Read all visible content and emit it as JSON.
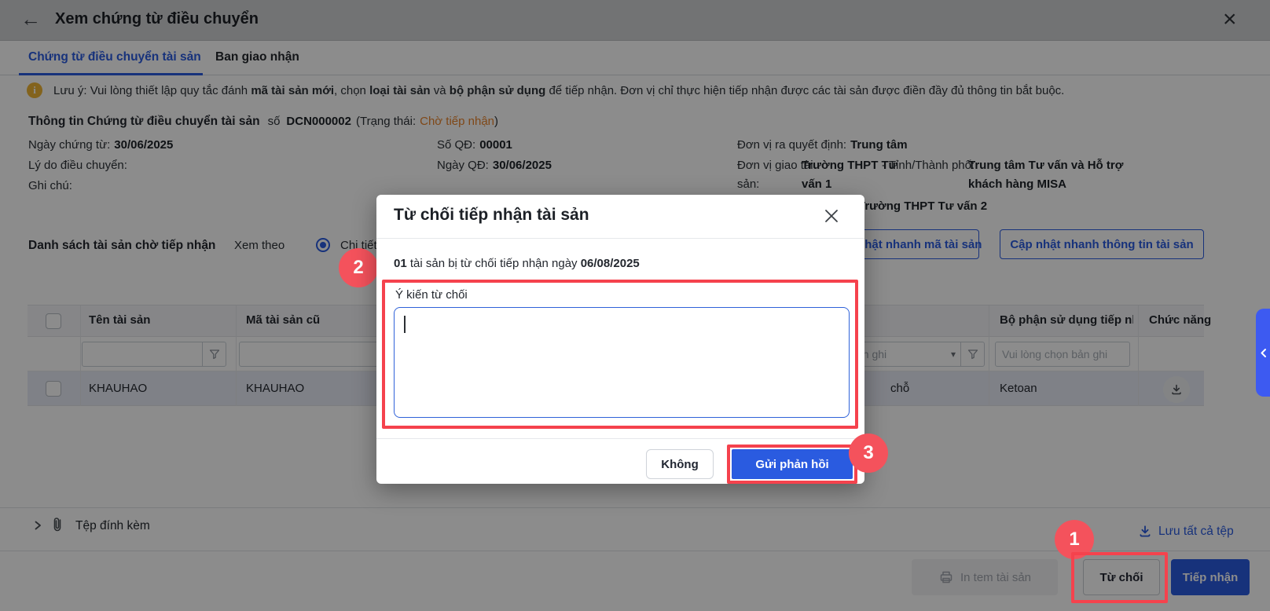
{
  "window": {
    "title": "Xem chứng từ điều chuyển"
  },
  "tabs": {
    "tab1": "Chứng từ điều chuyển tài sản",
    "tab2": "Ban giao nhận"
  },
  "notice": {
    "n1": "Lưu ý: Vui lòng thiết lập quy tắc đánh ",
    "n2": "mã tài sản mới",
    "n3": ", chọn ",
    "n4": "loại tài sản",
    "n5": " và ",
    "n6": "bộ phận sử dụng",
    "n7": " để tiếp nhận. Đơn vị chỉ thực hiện tiếp nhận được các tài sản được điền đầy đủ thông tin bắt buộc."
  },
  "info": {
    "section_title": "Thông tin Chứng từ điều chuyển tài sản",
    "doc_no_prefix": "số",
    "doc_no": "DCN000002",
    "status_prefix": "(Trạng thái:",
    "status": "Chờ tiếp nhận",
    "status_suffix": ")",
    "date_label": "Ngày chứng từ:",
    "date_value": "30/06/2025",
    "reason_label": "Lý do điều chuyển:",
    "note_label": "Ghi chú:",
    "qd_no_label": "Số QĐ:",
    "qd_no": "00001",
    "qd_date_label": "Ngày QĐ:",
    "qd_date": "30/06/2025",
    "issuer_label": "Đơn vị ra quyết định:",
    "issuer": "Trung tâm",
    "giver_label_1": "Đơn vị giao tài",
    "giver_label_2": "sản:",
    "giver_value_1": "Trường THPT Tư",
    "giver_value_2": "vấn 1",
    "province_label": "- Tỉnh/Thành phố:",
    "province_value_1": "Trung tâm Tư vấn và Hỗ trợ",
    "province_value_2": "khách hàng MISA",
    "receiver_value": "Trường THPT Tư vấn 2"
  },
  "list": {
    "title": "Danh sách tài sản chờ tiếp nhận",
    "view_by": "Xem theo",
    "view_detail": "Chi tiết",
    "quick_code_btn": "Cập nhật nhanh mã tài sản",
    "quick_info_btn": "Cập nhật nhanh thông tin tài sản"
  },
  "table": {
    "col_name": "Tên tài sản",
    "col_old_code": "Mã tài sản cũ",
    "col_dept": "Bộ phận sử dụng tiếp nhận",
    "col_actions": "Chức năng",
    "filter_select_placeholder": "Vui lòng chọn bản ghi",
    "row": {
      "name": "KHAUHAO",
      "old_code": "KHAUHAO",
      "location_fragment": "chỗ",
      "dept": "Ketoan"
    }
  },
  "attachments": {
    "label": "Tệp đính kèm",
    "save_all": "Lưu tất cả tệp"
  },
  "actions": {
    "print": "In tem tài sản",
    "reject": "Từ chối",
    "accept": "Tiếp nhận"
  },
  "modal": {
    "title": "Từ chối tiếp nhận tài sản",
    "count": "01",
    "body_text": " tài sản bị từ chối tiếp nhận ngày ",
    "date": "06/08/2025",
    "comment_label": "Ý kiến từ chối",
    "cancel": "Không",
    "submit": "Gửi phản hồi"
  },
  "steps": {
    "one": "1",
    "two": "2",
    "three": "3"
  },
  "colors": {
    "accent": "#2a5be0",
    "status_orange": "#e8842c",
    "annotation_red": "#f5424d",
    "row_selected": "#e8ecf6"
  }
}
